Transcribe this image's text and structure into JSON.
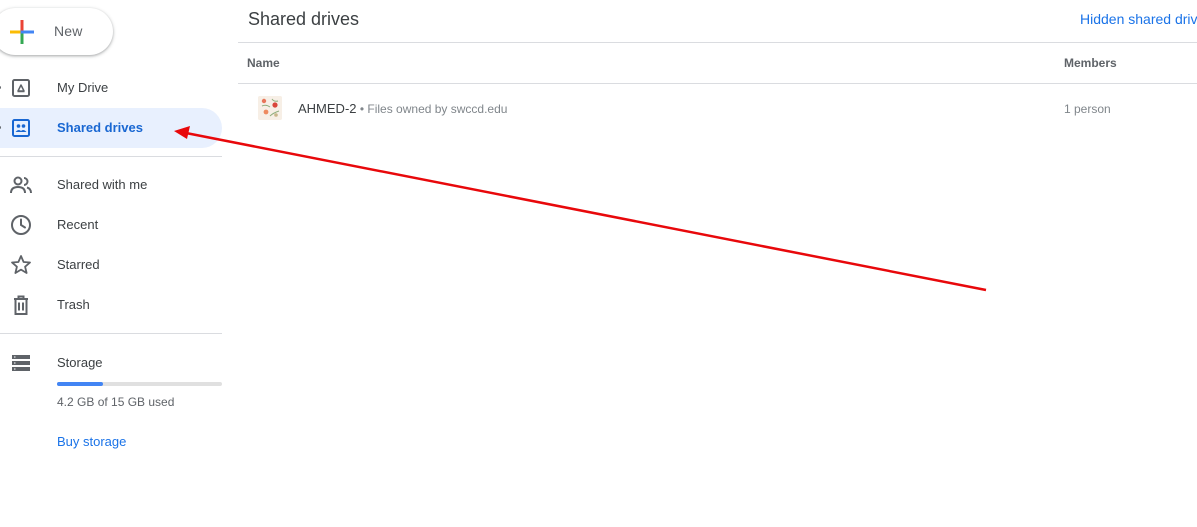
{
  "sidebar": {
    "new_label": "New",
    "items": [
      {
        "label": "My Drive",
        "icon": "my-drive-icon",
        "active": false
      },
      {
        "label": "Shared drives",
        "icon": "shared-drives-icon",
        "active": true
      },
      {
        "label": "Shared with me",
        "icon": "people-icon",
        "active": false
      },
      {
        "label": "Recent",
        "icon": "clock-icon",
        "active": false
      },
      {
        "label": "Starred",
        "icon": "star-icon",
        "active": false
      },
      {
        "label": "Trash",
        "icon": "trash-icon",
        "active": false
      },
      {
        "label": "Storage",
        "icon": "storage-icon",
        "active": false
      }
    ],
    "storage": {
      "used_text": "4.2 GB of 15 GB used",
      "fraction_used": 0.28,
      "buy_label": "Buy storage"
    }
  },
  "main": {
    "title": "Shared drives",
    "hidden_link": "Hidden shared drives",
    "columns": {
      "name": "Name",
      "members": "Members"
    },
    "rows": [
      {
        "name": "AHMED-2",
        "subtitle": " • Files owned by swccd.edu",
        "members": "1 person"
      }
    ]
  },
  "colors": {
    "accent": "#1a73e8",
    "active_bg": "#e8f0fe",
    "annotation_arrow": "#e8080b"
  }
}
